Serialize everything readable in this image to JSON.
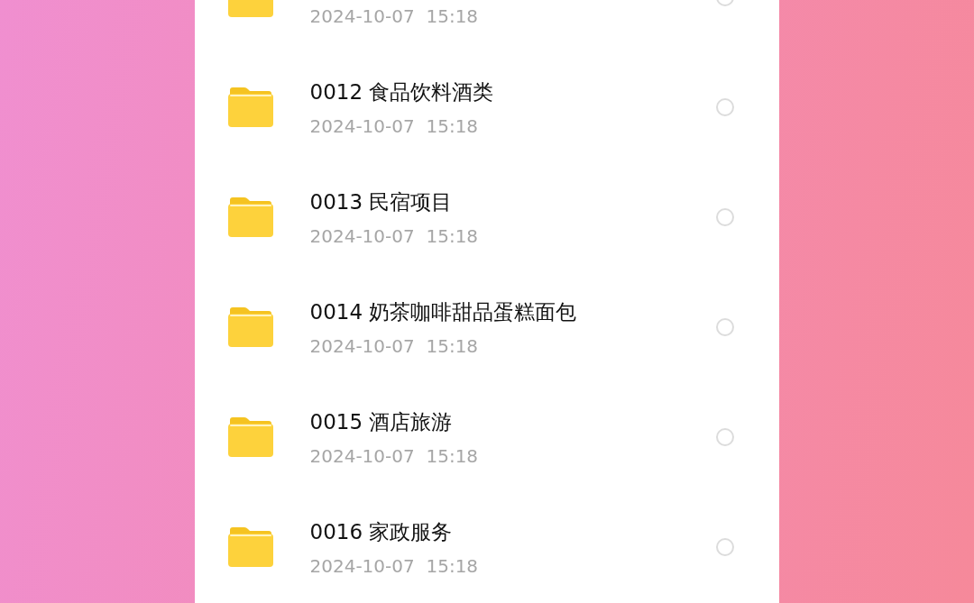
{
  "files": [
    {
      "date": "2024-10-07  15:18",
      "selected": false
    },
    {
      "name": "0012 食品饮料酒类",
      "date": "2024-10-07  15:18",
      "selected": false
    },
    {
      "name": "0013 民宿项目",
      "date": "2024-10-07  15:18",
      "selected": false
    },
    {
      "name": "0014 奶茶咖啡甜品蛋糕面包",
      "date": "2024-10-07  15:18",
      "selected": false
    },
    {
      "name": "0015 酒店旅游",
      "date": "2024-10-07  15:18",
      "selected": false
    },
    {
      "name": "0016 家政服务",
      "date": "2024-10-07  15:18",
      "selected": false
    }
  ]
}
